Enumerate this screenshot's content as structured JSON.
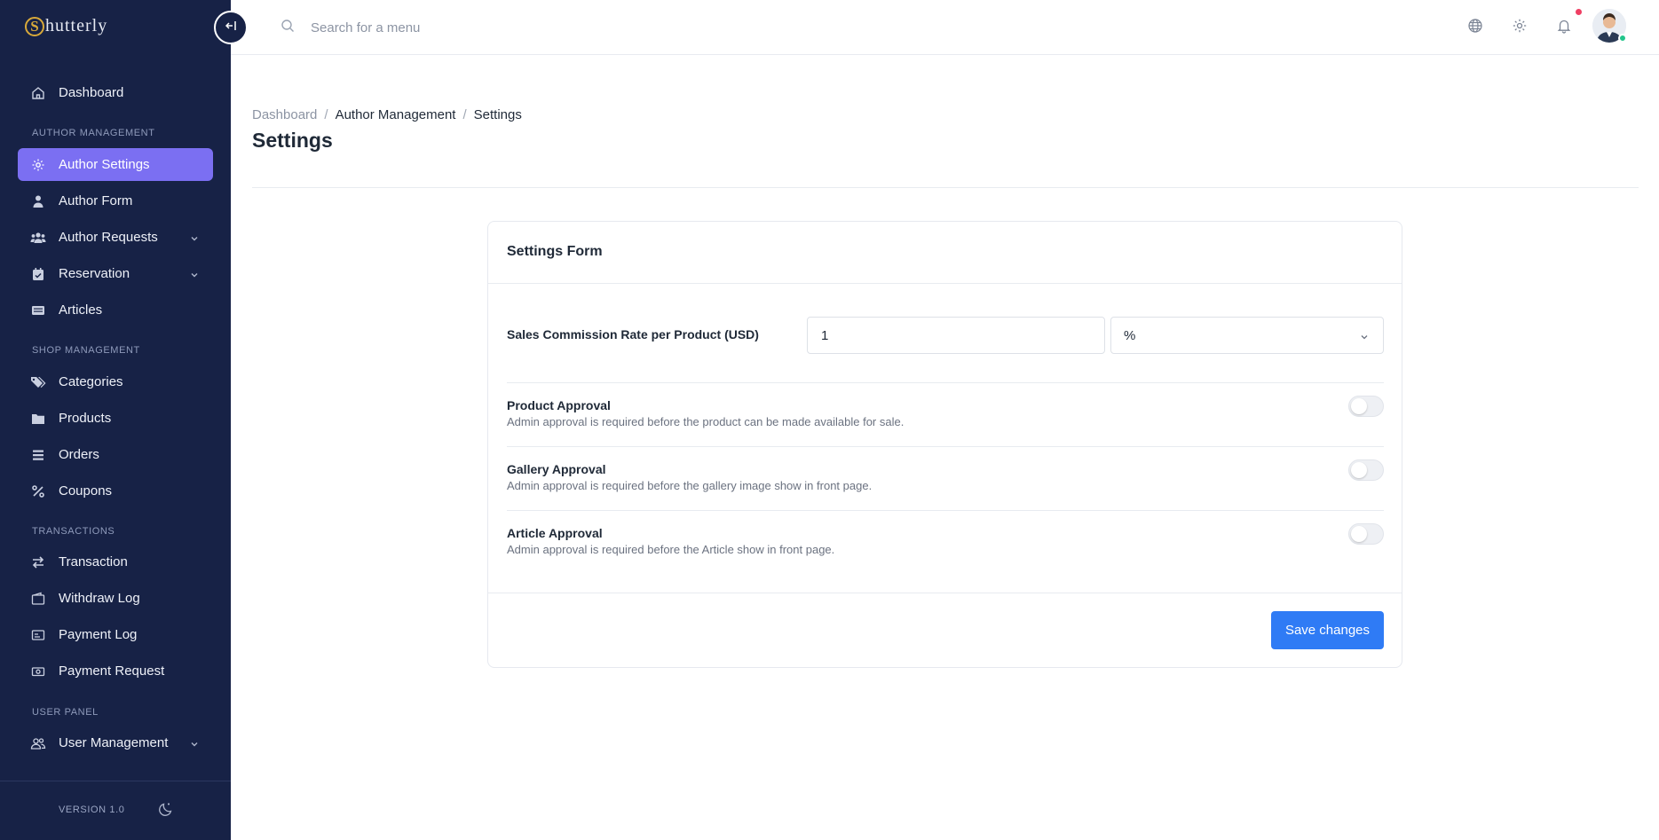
{
  "brand": {
    "mark": "S",
    "name": "hutterly",
    "accent": "#d8a93a"
  },
  "sidebar": {
    "bg": "#172246",
    "active_color": "#7b6ff2",
    "dashboard": "Dashboard",
    "sections": [
      "AUTHOR MANAGEMENT",
      "SHOP MANAGEMENT",
      "TRANSACTIONS",
      "USER PANEL"
    ],
    "items": [
      {
        "label": "Author Settings",
        "icon": "gear-icon",
        "active": true
      },
      {
        "label": "Author Form",
        "icon": "user-icon"
      },
      {
        "label": "Author Requests",
        "icon": "users-icon",
        "expandable": true
      },
      {
        "label": "Reservation",
        "icon": "calendar-check-icon",
        "expandable": true
      },
      {
        "label": "Articles",
        "icon": "newspaper-icon"
      },
      {
        "label": "Categories",
        "icon": "tags-icon"
      },
      {
        "label": "Products",
        "icon": "folder-icon"
      },
      {
        "label": "Orders",
        "icon": "list-icon"
      },
      {
        "label": "Coupons",
        "icon": "percent-icon"
      },
      {
        "label": "Transaction",
        "icon": "arrows-exchange-icon"
      },
      {
        "label": "Withdraw Log",
        "icon": "wallet-icon"
      },
      {
        "label": "Payment Log",
        "icon": "receipt-icon"
      },
      {
        "label": "Payment Request",
        "icon": "cash-icon"
      },
      {
        "label": "User Management",
        "icon": "user-group-icon",
        "expandable": true
      }
    ],
    "version": "VERSION 1.0"
  },
  "topbar": {
    "search_placeholder": "Search for a menu",
    "icons": [
      "globe-icon",
      "gear-icon",
      "bell-icon",
      "avatar"
    ]
  },
  "breadcrumb": [
    "Dashboard",
    "Author Management",
    "Settings"
  ],
  "page_title": "Settings",
  "form": {
    "title": "Settings Form",
    "commission_label": "Sales Commission Rate per Product (USD)",
    "commission_value": "1",
    "commission_type": "%",
    "options": [
      {
        "title": "Product Approval",
        "desc": "Admin approval is required before the product can be made available for sale.",
        "enabled": false
      },
      {
        "title": "Gallery Approval",
        "desc": "Admin approval is required before the gallery image show in front page.",
        "enabled": false
      },
      {
        "title": "Article Approval",
        "desc": "Admin approval is required before the Article show in front page.",
        "enabled": false
      }
    ],
    "save_label": "Save changes",
    "save_color": "#2f7bf5"
  }
}
